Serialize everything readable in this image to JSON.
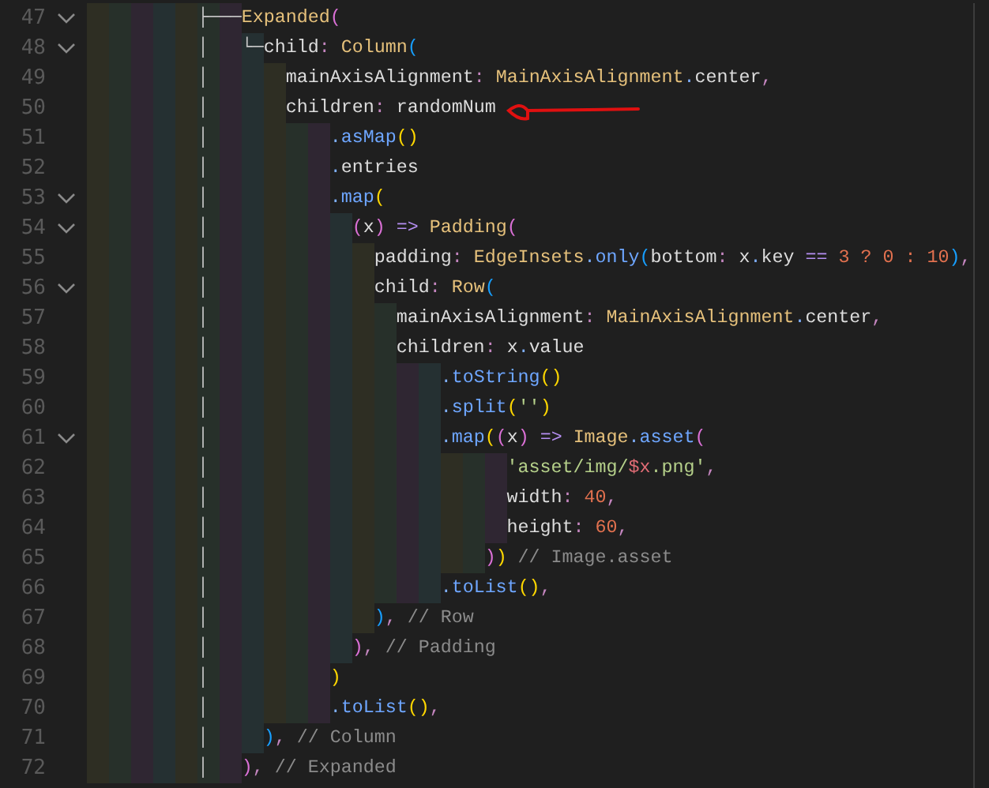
{
  "editor": {
    "lines": [
      {
        "number": "47",
        "foldable": true,
        "tokens": [
          {
            "kind": "guide",
            "text": "          ├───"
          },
          {
            "kind": "cls",
            "text": "Expanded"
          },
          {
            "kind": "p2",
            "text": "("
          }
        ]
      },
      {
        "number": "48",
        "foldable": true,
        "tokens": [
          {
            "kind": "guide",
            "text": "          │   └─"
          },
          {
            "kind": "id",
            "text": "child"
          },
          {
            "kind": "punc",
            "text": ": "
          },
          {
            "kind": "cls",
            "text": "Column"
          },
          {
            "kind": "p3",
            "text": "("
          }
        ]
      },
      {
        "number": "49",
        "foldable": false,
        "tokens": [
          {
            "kind": "guide",
            "text": "          │       "
          },
          {
            "kind": "id",
            "text": "mainAxisAlignment"
          },
          {
            "kind": "punc",
            "text": ": "
          },
          {
            "kind": "cls",
            "text": "MainAxisAlignment"
          },
          {
            "kind": "dot",
            "text": "."
          },
          {
            "kind": "id",
            "text": "center"
          },
          {
            "kind": "punc",
            "text": ","
          }
        ]
      },
      {
        "number": "50",
        "foldable": false,
        "tokens": [
          {
            "kind": "guide",
            "text": "          │       "
          },
          {
            "kind": "id",
            "text": "children"
          },
          {
            "kind": "punc",
            "text": ": "
          },
          {
            "kind": "id",
            "text": "randomNum"
          }
        ]
      },
      {
        "number": "51",
        "foldable": false,
        "tokens": [
          {
            "kind": "guide",
            "text": "          │           "
          },
          {
            "kind": "dot",
            "text": "."
          },
          {
            "kind": "fn",
            "text": "asMap"
          },
          {
            "kind": "p1",
            "text": "()"
          }
        ]
      },
      {
        "number": "52",
        "foldable": false,
        "tokens": [
          {
            "kind": "guide",
            "text": "          │           "
          },
          {
            "kind": "dot",
            "text": "."
          },
          {
            "kind": "id",
            "text": "entries"
          }
        ]
      },
      {
        "number": "53",
        "foldable": true,
        "tokens": [
          {
            "kind": "guide",
            "text": "          │           "
          },
          {
            "kind": "dot",
            "text": "."
          },
          {
            "kind": "fn",
            "text": "map"
          },
          {
            "kind": "p1",
            "text": "("
          }
        ]
      },
      {
        "number": "54",
        "foldable": true,
        "tokens": [
          {
            "kind": "guide",
            "text": "          │             "
          },
          {
            "kind": "p2",
            "text": "("
          },
          {
            "kind": "id",
            "text": "x"
          },
          {
            "kind": "p2",
            "text": ")"
          },
          {
            "kind": "op",
            "text": " => "
          },
          {
            "kind": "cls",
            "text": "Padding"
          },
          {
            "kind": "p2",
            "text": "("
          }
        ]
      },
      {
        "number": "55",
        "foldable": false,
        "tokens": [
          {
            "kind": "guide",
            "text": "          │               "
          },
          {
            "kind": "id",
            "text": "padding"
          },
          {
            "kind": "punc",
            "text": ": "
          },
          {
            "kind": "cls",
            "text": "EdgeInsets"
          },
          {
            "kind": "dot",
            "text": "."
          },
          {
            "kind": "fn",
            "text": "only"
          },
          {
            "kind": "p3",
            "text": "("
          },
          {
            "kind": "id",
            "text": "bottom"
          },
          {
            "kind": "punc",
            "text": ": "
          },
          {
            "kind": "id",
            "text": "x"
          },
          {
            "kind": "dot",
            "text": "."
          },
          {
            "kind": "id",
            "text": "key"
          },
          {
            "kind": "op",
            "text": " == "
          },
          {
            "kind": "num",
            "text": "3 ? 0 : 10"
          },
          {
            "kind": "p3",
            "text": ")"
          },
          {
            "kind": "punc",
            "text": ","
          }
        ]
      },
      {
        "number": "56",
        "foldable": true,
        "tokens": [
          {
            "kind": "guide",
            "text": "          │               "
          },
          {
            "kind": "id",
            "text": "child"
          },
          {
            "kind": "punc",
            "text": ": "
          },
          {
            "kind": "cls",
            "text": "Row"
          },
          {
            "kind": "p3",
            "text": "("
          }
        ]
      },
      {
        "number": "57",
        "foldable": false,
        "tokens": [
          {
            "kind": "guide",
            "text": "          │                 "
          },
          {
            "kind": "id",
            "text": "mainAxisAlignment"
          },
          {
            "kind": "punc",
            "text": ": "
          },
          {
            "kind": "cls",
            "text": "MainAxisAlignment"
          },
          {
            "kind": "dot",
            "text": "."
          },
          {
            "kind": "id",
            "text": "center"
          },
          {
            "kind": "punc",
            "text": ","
          }
        ]
      },
      {
        "number": "58",
        "foldable": false,
        "tokens": [
          {
            "kind": "guide",
            "text": "          │                 "
          },
          {
            "kind": "id",
            "text": "children"
          },
          {
            "kind": "punc",
            "text": ": "
          },
          {
            "kind": "id",
            "text": "x"
          },
          {
            "kind": "dot",
            "text": "."
          },
          {
            "kind": "id",
            "text": "value"
          }
        ]
      },
      {
        "number": "59",
        "foldable": false,
        "tokens": [
          {
            "kind": "guide",
            "text": "          │                     "
          },
          {
            "kind": "dot",
            "text": "."
          },
          {
            "kind": "fn",
            "text": "toString"
          },
          {
            "kind": "p1",
            "text": "()"
          }
        ]
      },
      {
        "number": "60",
        "foldable": false,
        "tokens": [
          {
            "kind": "guide",
            "text": "          │                     "
          },
          {
            "kind": "dot",
            "text": "."
          },
          {
            "kind": "fn",
            "text": "split"
          },
          {
            "kind": "p1",
            "text": "("
          },
          {
            "kind": "str",
            "text": "''"
          },
          {
            "kind": "p1",
            "text": ")"
          }
        ]
      },
      {
        "number": "61",
        "foldable": true,
        "tokens": [
          {
            "kind": "guide",
            "text": "          │                     "
          },
          {
            "kind": "dot",
            "text": "."
          },
          {
            "kind": "fn",
            "text": "map"
          },
          {
            "kind": "p1",
            "text": "("
          },
          {
            "kind": "p2",
            "text": "("
          },
          {
            "kind": "id",
            "text": "x"
          },
          {
            "kind": "p2",
            "text": ")"
          },
          {
            "kind": "op",
            "text": " => "
          },
          {
            "kind": "cls",
            "text": "Image"
          },
          {
            "kind": "dot",
            "text": "."
          },
          {
            "kind": "fn",
            "text": "asset"
          },
          {
            "kind": "p2",
            "text": "("
          }
        ]
      },
      {
        "number": "62",
        "foldable": false,
        "tokens": [
          {
            "kind": "guide",
            "text": "          │                           "
          },
          {
            "kind": "str",
            "text": "'asset/img/"
          },
          {
            "kind": "interp",
            "text": "$x"
          },
          {
            "kind": "str",
            "text": ".png'"
          },
          {
            "kind": "punc",
            "text": ","
          }
        ]
      },
      {
        "number": "63",
        "foldable": false,
        "tokens": [
          {
            "kind": "guide",
            "text": "          │                           "
          },
          {
            "kind": "id",
            "text": "width"
          },
          {
            "kind": "punc",
            "text": ": "
          },
          {
            "kind": "num",
            "text": "40"
          },
          {
            "kind": "punc",
            "text": ","
          }
        ]
      },
      {
        "number": "64",
        "foldable": false,
        "tokens": [
          {
            "kind": "guide",
            "text": "          │                           "
          },
          {
            "kind": "id",
            "text": "height"
          },
          {
            "kind": "punc",
            "text": ": "
          },
          {
            "kind": "num",
            "text": "60"
          },
          {
            "kind": "punc",
            "text": ","
          }
        ]
      },
      {
        "number": "65",
        "foldable": false,
        "tokens": [
          {
            "kind": "guide",
            "text": "          │                         "
          },
          {
            "kind": "p2",
            "text": ")"
          },
          {
            "kind": "p1",
            "text": ")"
          },
          {
            "kind": "comment",
            "text": " // Image.asset"
          }
        ]
      },
      {
        "number": "66",
        "foldable": false,
        "tokens": [
          {
            "kind": "guide",
            "text": "          │                     "
          },
          {
            "kind": "dot",
            "text": "."
          },
          {
            "kind": "fn",
            "text": "toList"
          },
          {
            "kind": "p1",
            "text": "()"
          },
          {
            "kind": "punc",
            "text": ","
          }
        ]
      },
      {
        "number": "67",
        "foldable": false,
        "tokens": [
          {
            "kind": "guide",
            "text": "          │               "
          },
          {
            "kind": "p3",
            "text": ")"
          },
          {
            "kind": "punc",
            "text": ","
          },
          {
            "kind": "comment",
            "text": " // Row"
          }
        ]
      },
      {
        "number": "68",
        "foldable": false,
        "tokens": [
          {
            "kind": "guide",
            "text": "          │             "
          },
          {
            "kind": "p2",
            "text": ")"
          },
          {
            "kind": "punc",
            "text": ","
          },
          {
            "kind": "comment",
            "text": " // Padding"
          }
        ]
      },
      {
        "number": "69",
        "foldable": false,
        "tokens": [
          {
            "kind": "guide",
            "text": "          │           "
          },
          {
            "kind": "p1",
            "text": ")"
          }
        ]
      },
      {
        "number": "70",
        "foldable": false,
        "tokens": [
          {
            "kind": "guide",
            "text": "          │           "
          },
          {
            "kind": "dot",
            "text": "."
          },
          {
            "kind": "fn",
            "text": "toList"
          },
          {
            "kind": "p1",
            "text": "()"
          },
          {
            "kind": "punc",
            "text": ","
          }
        ]
      },
      {
        "number": "71",
        "foldable": false,
        "tokens": [
          {
            "kind": "guide",
            "text": "          │     "
          },
          {
            "kind": "p3",
            "text": ")"
          },
          {
            "kind": "punc",
            "text": ","
          },
          {
            "kind": "comment",
            "text": " // Column"
          }
        ]
      },
      {
        "number": "72",
        "foldable": false,
        "tokens": [
          {
            "kind": "guide",
            "text": "          │   "
          },
          {
            "kind": "p2",
            "text": ")"
          },
          {
            "kind": "punc",
            "text": ","
          },
          {
            "kind": "comment",
            "text": " // Expanded"
          }
        ]
      }
    ]
  }
}
